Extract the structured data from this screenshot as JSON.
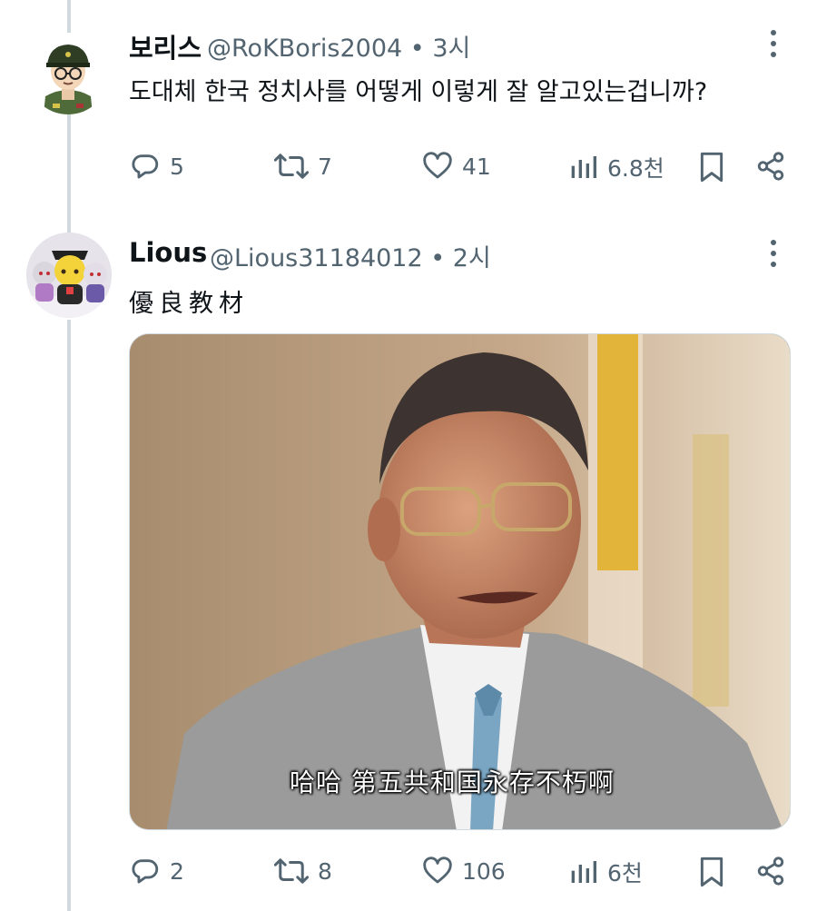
{
  "tweets": [
    {
      "name": "보리스",
      "handle": "@RoKBoris2004",
      "time": "3시",
      "text": "도대체 한국 정치사를 어떻게 이렇게 잘 알고있는겁니까?",
      "replies": "5",
      "retweets": "7",
      "likes": "41",
      "views": "6.8천"
    },
    {
      "name": "Lious",
      "handle": "@Lious31184012",
      "time": "2시",
      "text": "優良教材",
      "media_subtitle": "哈哈 第五共和国永存不朽啊",
      "replies": "2",
      "retweets": "8",
      "likes": "106",
      "views": "6천"
    }
  ],
  "separator": "•",
  "icons": [
    "more-icon",
    "reply-icon",
    "retweet-icon",
    "like-icon",
    "views-icon",
    "bookmark-icon",
    "share-icon"
  ],
  "colors": {
    "text": "#0f1419",
    "secondary": "#536471",
    "thread_line": "#cfd9de"
  }
}
